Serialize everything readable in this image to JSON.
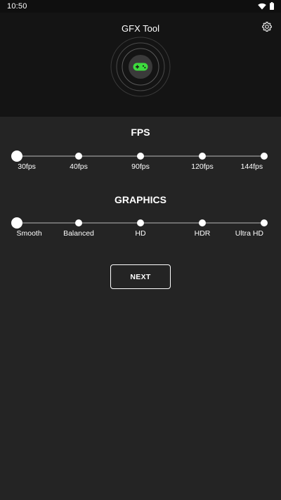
{
  "status_bar": {
    "time": "10:50",
    "icons": [
      "wifi-icon",
      "battery-icon"
    ]
  },
  "header": {
    "title": "GFX Tool",
    "settings_icon": "gear-icon",
    "logo_icon": "gamepad-icon"
  },
  "fps": {
    "title": "FPS",
    "options": [
      "30fps",
      "40fps",
      "90fps",
      "120fps",
      "144fps"
    ],
    "selected_index": 0
  },
  "graphics": {
    "title": "GRAPHICS",
    "options": [
      "Smooth",
      "Balanced",
      "HD",
      "HDR",
      "Ultra HD"
    ],
    "selected_index": 0
  },
  "actions": {
    "next_label": "NEXT"
  },
  "colors": {
    "background": "#242424",
    "header_background": "#141414",
    "accent_green": "#3ddc3d",
    "track": "#6e6e6e",
    "text": "#ffffff"
  }
}
